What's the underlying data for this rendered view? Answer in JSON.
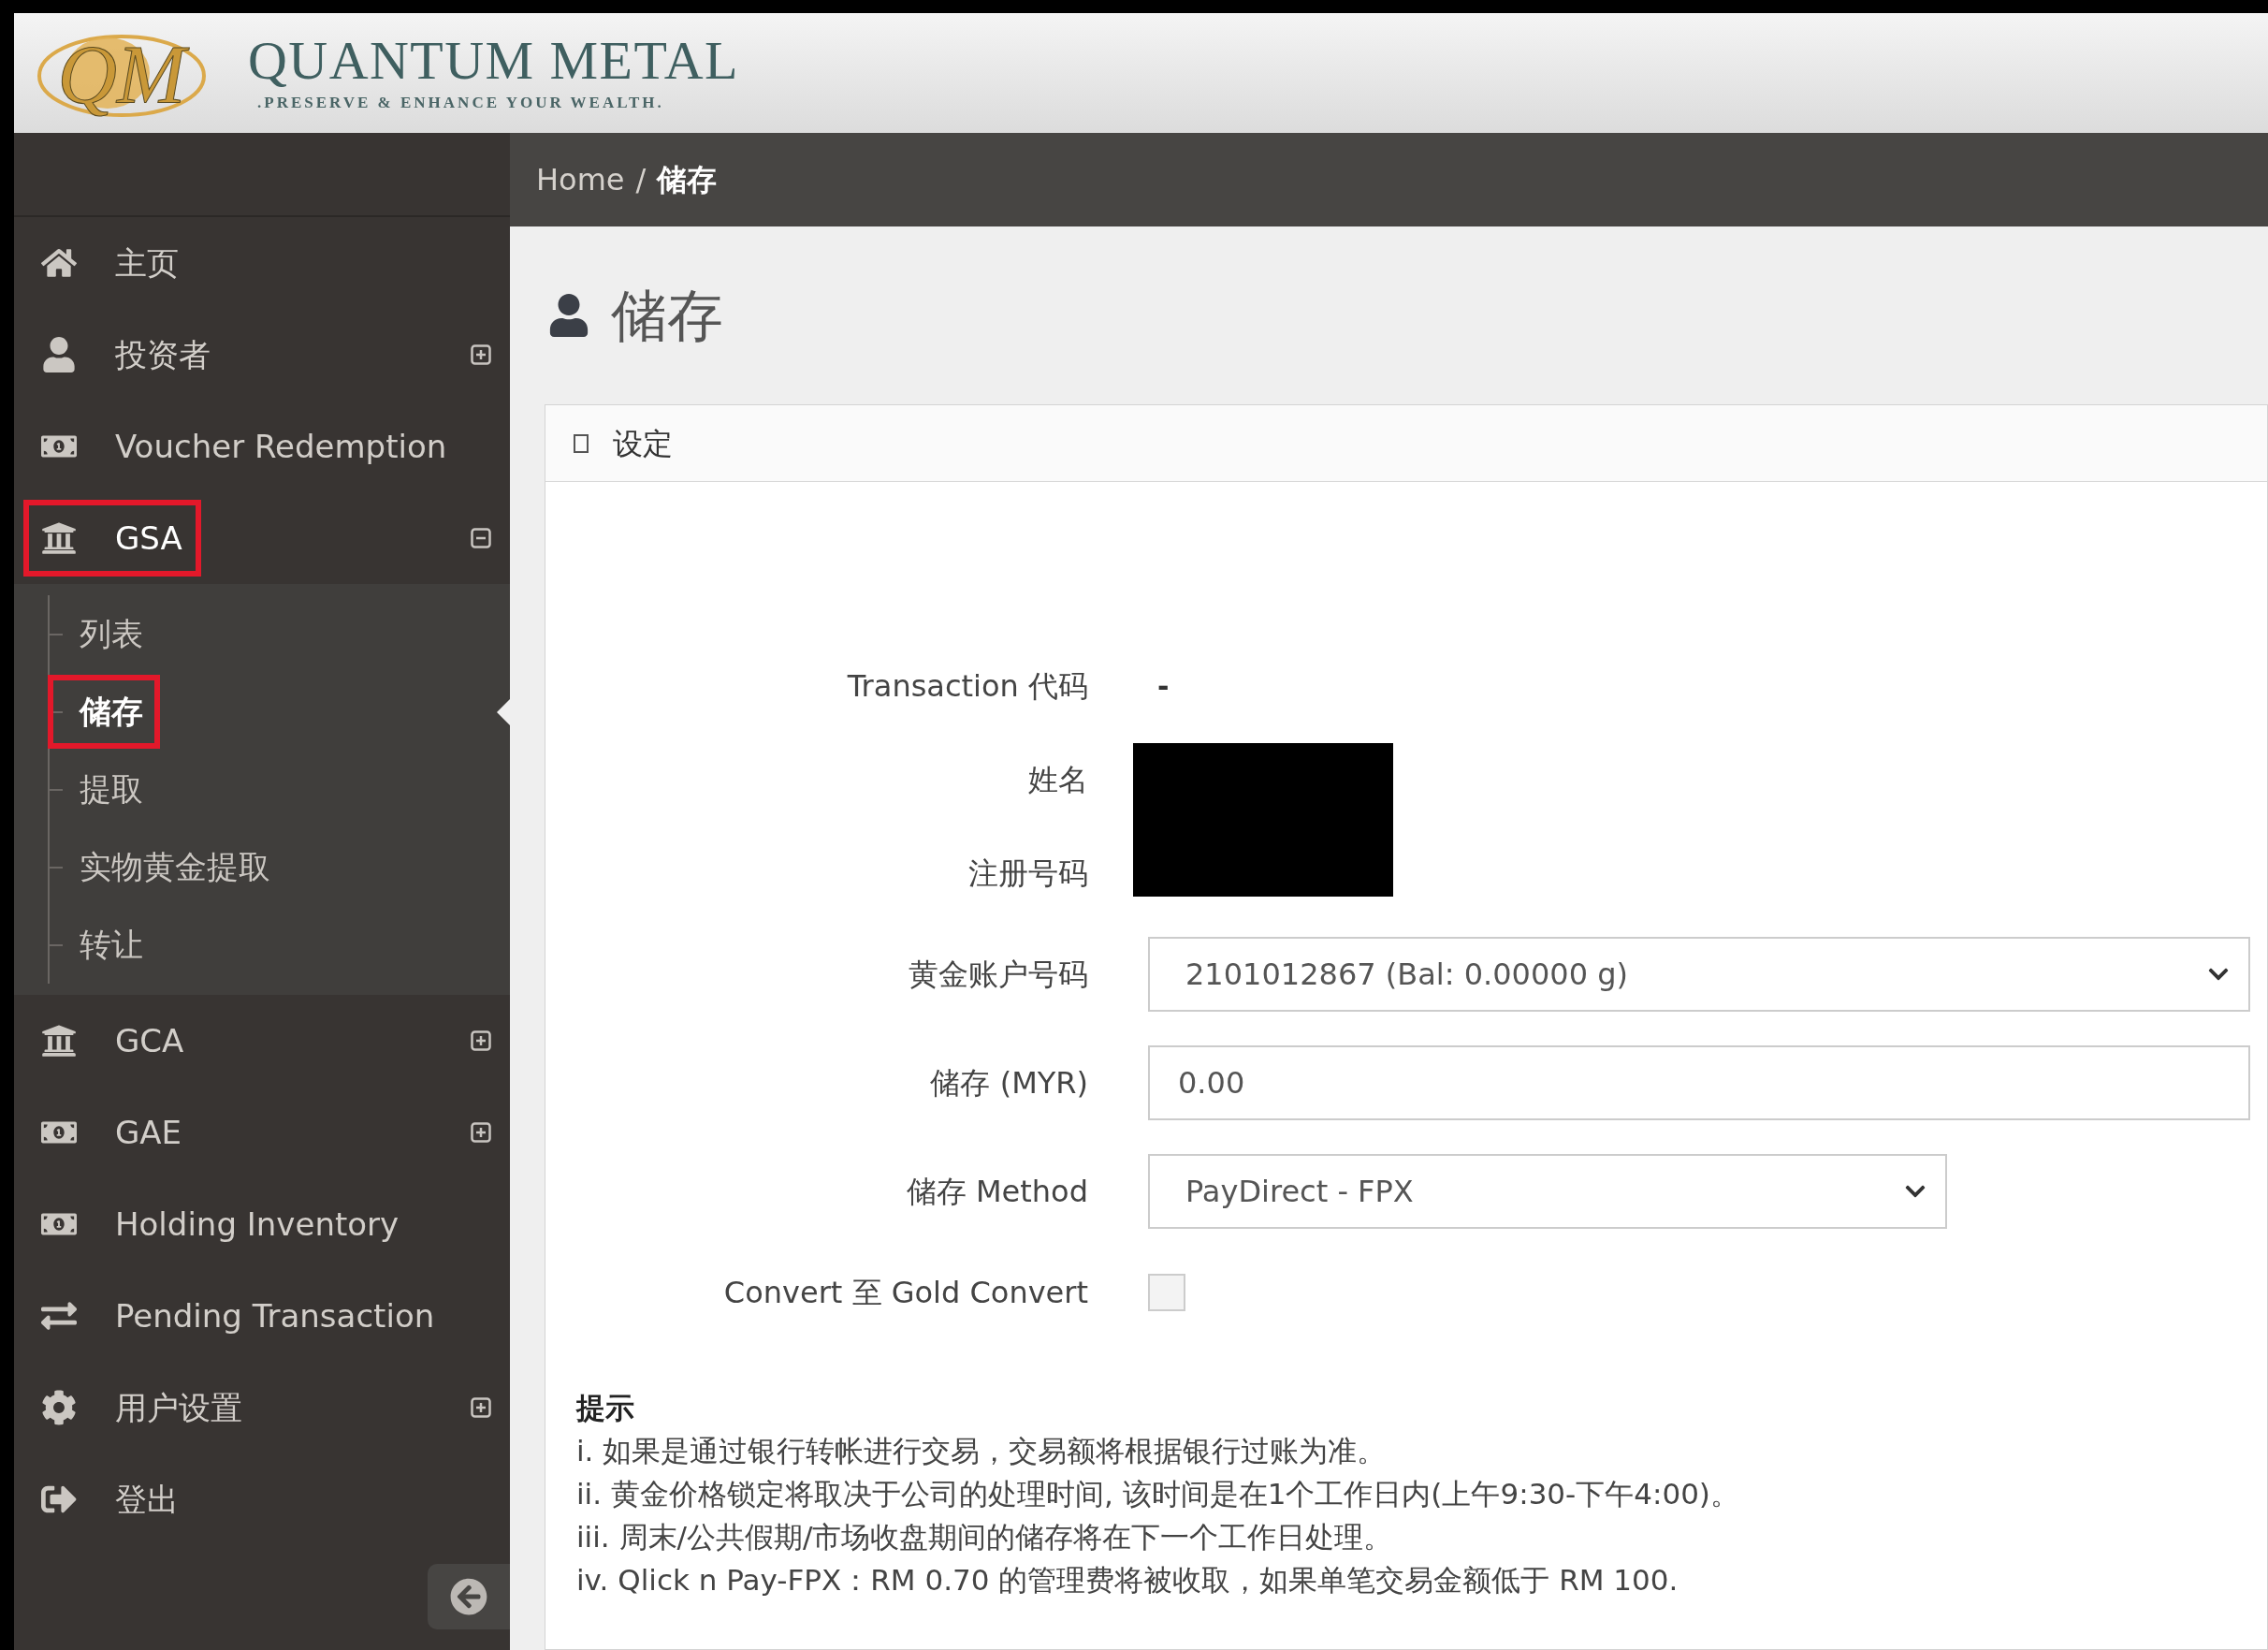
{
  "logo": {
    "mark": "QM",
    "name": "QUANTUM METAL",
    "tagline": ".PRESERVE & ENHANCE YOUR WEALTH."
  },
  "breadcrumb_separator": "/",
  "breadcrumb": [
    {
      "label": "Home",
      "selected": false
    },
    {
      "label": "储存",
      "selected": true
    }
  ],
  "sidebar": {
    "items": [
      {
        "label": "主页",
        "kind": "link",
        "highlighted": false
      },
      {
        "label": "投资者",
        "kind": "group",
        "expanded": false,
        "highlighted": false
      },
      {
        "label": "Voucher Redemption",
        "kind": "link",
        "highlighted": false
      },
      {
        "label": "GSA",
        "kind": "group",
        "expanded": true,
        "highlighted": true,
        "children": [
          {
            "label": "列表",
            "selected": false,
            "highlighted": false
          },
          {
            "label": "储存",
            "selected": true,
            "highlighted": true
          },
          {
            "label": "提取",
            "selected": false,
            "highlighted": false
          },
          {
            "label": "实物黄金提取",
            "selected": false,
            "highlighted": false
          },
          {
            "label": "转让",
            "selected": false,
            "highlighted": false
          }
        ]
      },
      {
        "label": "GCA",
        "kind": "group",
        "expanded": false,
        "highlighted": false
      },
      {
        "label": "GAE",
        "kind": "group",
        "expanded": false,
        "highlighted": false
      },
      {
        "label": "Holding Inventory",
        "kind": "link",
        "highlighted": false
      },
      {
        "label": "Pending Transaction",
        "kind": "link",
        "highlighted": false
      },
      {
        "label": "用户设置",
        "kind": "group",
        "expanded": false,
        "highlighted": false
      },
      {
        "label": "登出",
        "kind": "link",
        "highlighted": false
      }
    ]
  },
  "page_title": "储存",
  "panel": {
    "title": "设定",
    "fields": [
      {
        "label": "Transaction 代码",
        "kind": "text",
        "value": "-"
      },
      {
        "label": "姓名",
        "kind": "redacted"
      },
      {
        "label": "注册号码",
        "kind": "redacted"
      },
      {
        "label": "黄金账户号码",
        "kind": "select",
        "value": "2101012867 (Bal: 0.00000 g)",
        "wide": true
      },
      {
        "label": "储存 (MYR)",
        "kind": "input",
        "value": "0.00"
      },
      {
        "label": "储存 Method",
        "kind": "select",
        "value": "PayDirect - FPX",
        "wide": false
      },
      {
        "label": "Convert 至 Gold Convert",
        "kind": "checkbox",
        "checked": false
      }
    ],
    "notes": {
      "title": "提示",
      "lines": [
        "i. 如果是通过银行转帐进行交易，交易额将根据银行过账为准。",
        "ii. 黄金价格锁定将取决于公司的处理时间, 该时间是在1个工作日内(上午9:30-下午4:00)。",
        "iii. 周末/公共假期/市场收盘期间的储存将在下一个工作日处理。",
        "iv. Qlick n Pay-FPX：RM 0.70 的管理费将被收取，如果单笔交易金额低于 RM 100."
      ]
    }
  }
}
